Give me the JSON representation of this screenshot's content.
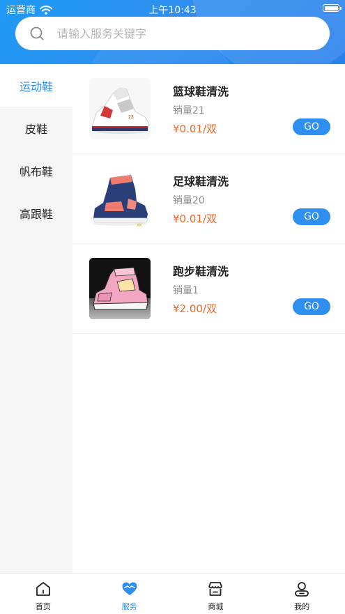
{
  "status_bar": {
    "carrier": "运营商",
    "time": "上午10:43"
  },
  "search": {
    "placeholder": "请输入服务关键字",
    "value": ""
  },
  "sidebar": {
    "items": [
      {
        "label": "运动鞋",
        "active": true
      },
      {
        "label": "皮鞋",
        "active": false
      },
      {
        "label": "帆布鞋",
        "active": false
      },
      {
        "label": "高跟鞋",
        "active": false
      }
    ]
  },
  "products": [
    {
      "name": "篮球鞋清洗",
      "sales": "销量21",
      "price": "¥0.01/双",
      "button": "GO",
      "image": "white-basketball-sneaker"
    },
    {
      "name": "足球鞋清洗",
      "sales": "销量20",
      "price": "¥0.01/双",
      "button": "GO",
      "image": "navy-pink-high-top-sneaker"
    },
    {
      "name": "跑步鞋清洗",
      "sales": "销量1",
      "price": "¥2.00/双",
      "button": "GO",
      "image": "pink-cartoon-sneaker"
    }
  ],
  "tabbar": {
    "tabs": [
      {
        "label": "首页",
        "icon": "home-icon",
        "active": false
      },
      {
        "label": "服务",
        "icon": "heart-service-icon",
        "active": true
      },
      {
        "label": "商城",
        "icon": "store-icon",
        "active": false
      },
      {
        "label": "我的",
        "icon": "user-icon",
        "active": false
      }
    ]
  },
  "colors": {
    "primary": "#2e8ff0",
    "price": "#f26522",
    "sidebar_bg": "#f5f5f5"
  }
}
